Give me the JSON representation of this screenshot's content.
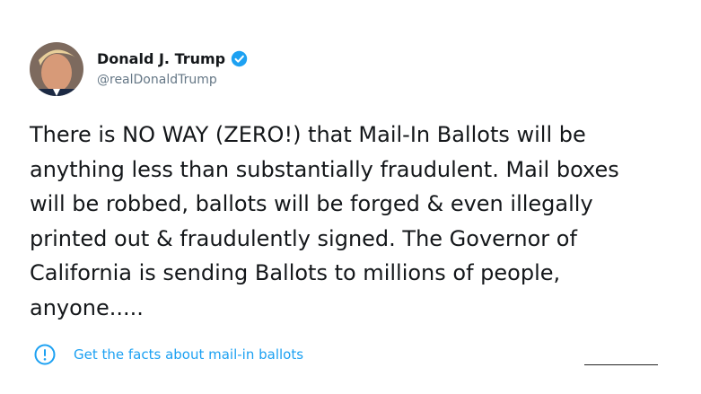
{
  "author": {
    "name": "Donald J. Trump",
    "handle": "@realDonaldTrump",
    "verified_icon": "verified-badge-icon",
    "avatar_icon": "profile-photo"
  },
  "tweet": {
    "lines": [
      "There is NO WAY (ZERO!) that Mail-In Ballots will be",
      "anything less than substantially fraudulent. Mail boxes",
      "will be robbed, ballots will be forged & even illegally",
      "printed out & fraudulently signed. The Governor of",
      "California is sending Ballots to millions of people,",
      "anyone....."
    ]
  },
  "fact_check": {
    "label": "Get the facts about mail-in ballots",
    "icon": "exclamation-circle-icon"
  },
  "colors": {
    "accent": "#1da1f2",
    "text": "#14171a",
    "secondary": "#657786"
  }
}
